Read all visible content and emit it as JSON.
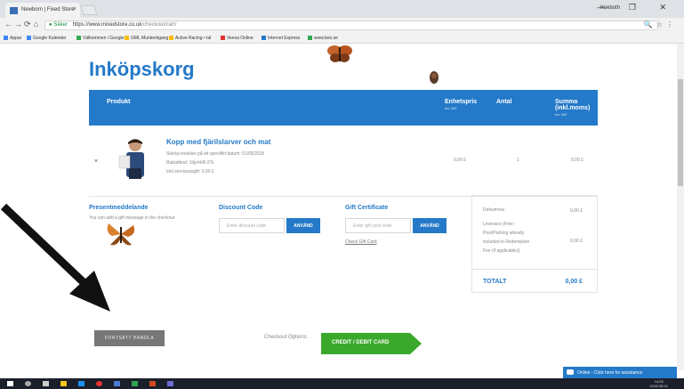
{
  "browser": {
    "tab_title": "Newborn | Fixed Store",
    "tab_close": "×",
    "user_name": "Hoeboth",
    "window_controls": "— ❐ ✕",
    "url_security": "Säker",
    "url_host": "https://www.mixedstore.co.uk",
    "url_path": "/checkout/cart/",
    "bookmarks": [
      {
        "label": "Appar",
        "color": "#4285f4"
      },
      {
        "label": "Google Kalender",
        "color": "#4285f4"
      },
      {
        "label": "Välkommen i Google",
        "color": "#34a853"
      },
      {
        "label": "GML Munkerkgang",
        "color": "#fbbc05"
      },
      {
        "label": "Active Racing • tal",
        "color": "#fbbc05"
      },
      {
        "label": "Veeva Online",
        "color": "#e0332f"
      },
      {
        "label": "Internet Express",
        "color": "#2479c8"
      },
      {
        "label": "www.boo.se",
        "color": "#34a853"
      }
    ]
  },
  "page": {
    "title": "Inköpskorg",
    "table_header": {
      "product": "Produkt",
      "unit_price": "Enhetspris",
      "unit_price_sub": "Inc VAT",
      "qty": "Antal",
      "sum": "Summa",
      "sum_line2": "(inkl.moms)",
      "sum_sub": "Inc VAT"
    },
    "product": {
      "remove": "×",
      "name": "Kopp med fjärilslarver och mat",
      "meta1": "Skicka insekter på ett specifikt datum:  01/05/2018",
      "meta2": "Rabattkod:   1tlg-hkB-27k",
      "meta3": "Inkl.serviceavgift:   0,00 £",
      "unit_price": "0,00 £",
      "qty": "1",
      "sum": "0,00 £"
    },
    "gift_message": {
      "heading": "Presentmeddelande",
      "text": "You can add a gift message in the checkout"
    },
    "discount": {
      "heading": "Discount Code",
      "placeholder": "Enter discount code",
      "button": "ANVÄND"
    },
    "gift_cert": {
      "heading": "Gift Certificate",
      "placeholder": "Enter gift card code",
      "button": "ANVÄND",
      "check_link": "Check Gift Card"
    },
    "totals": {
      "subtotal_label": "Delsumma",
      "subtotal_value": "0,00 £",
      "shipping_label_lines": [
        "Leverans (Free -",
        "Post/Parking already",
        "included in Redemption",
        "Fee (if applicable))"
      ],
      "shipping_value": "0,00 £",
      "total_label": "TOTALT",
      "total_value": "0,00 £"
    },
    "continue_button": "FORTSÄTT HANDLA",
    "checkout_options_label": "Checkout Options",
    "credit_button": "CREDIT / DEBIT CARD",
    "chat": "Online - Click here for assistance"
  },
  "taskbar": {
    "time": "14:25",
    "date": "2018-05-01"
  },
  "colors": {
    "accent": "#2479c8",
    "checkout_green": "#3aa82a",
    "continue_grey": "#777777"
  }
}
